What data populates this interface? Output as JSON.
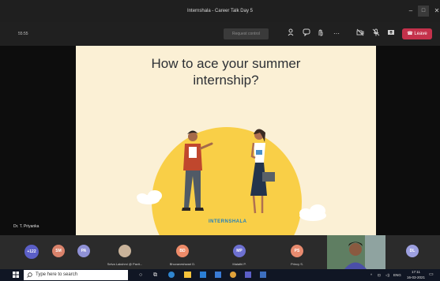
{
  "window": {
    "title": "Internshala - Career Talk Day 5"
  },
  "toolbar": {
    "timer": "55:55",
    "request_control_label": "Request control",
    "leave_label": "Leave"
  },
  "slide": {
    "title": "How to ace your summer\ninternship?",
    "brand": "INTERNSHALA"
  },
  "presenter": {
    "name": "Dr. T. Priyanka"
  },
  "participants": [
    {
      "initials": "+122",
      "name": "",
      "color": "#5b5fc7"
    },
    {
      "initials": "SM",
      "name": "",
      "color": "#d9826b"
    },
    {
      "initials": "PA",
      "name": "",
      "color": "#8f91d6"
    },
    {
      "initials": "",
      "name": "Selva Lakshmi @ Pavit...",
      "color": "#c9b39a"
    },
    {
      "initials": "BD",
      "name": "Bhuvaneshwari D.",
      "color": "#ee8b69"
    },
    {
      "initials": "MP",
      "name": "Malathi P.",
      "color": "#6d70d1"
    },
    {
      "initials": "PS",
      "name": "Princy S.",
      "color": "#e88b6f"
    },
    {
      "initials": "",
      "name": "",
      "color": "#6c8a6a"
    },
    {
      "initials": "DL",
      "name": "",
      "color": "#9da0e0"
    }
  ],
  "taskbar": {
    "search_placeholder": "Type here to search",
    "lang": "ENG",
    "time": "17:11",
    "date": "16-03-2021"
  },
  "colors": {
    "leave": "#c4314b",
    "slide_bg": "#fbf0d5",
    "sun": "#f9cf47",
    "brand": "#1f7fbd"
  }
}
